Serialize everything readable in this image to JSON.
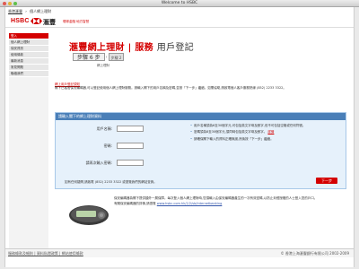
{
  "window": {
    "title": "Welcome to HSBC"
  },
  "breadcrumb": {
    "items": [
      "香港滙豐",
      "個人網上理財"
    ]
  },
  "brand": {
    "logo_text": "HSBC",
    "chinese_name": "滙豐",
    "tagline": "環球金融 地方智慧",
    "colors": {
      "brand_red": "#d40000",
      "panel_blue": "#4a7fb8",
      "panel_bg": "#e6f1fb"
    }
  },
  "sidebar": {
    "items": [
      "登入",
      "個人網上理財",
      "保安資訊",
      "使用條款",
      "最新消息",
      "常見問題",
      "聯絡我們"
    ]
  },
  "page": {
    "title_prefix": "滙豐網上理財",
    "title_sep": "|",
    "title_link": "服務",
    "title_main": "用戶登記",
    "step_current": "步驟 6 步",
    "step_next": "步驟 2",
    "step_sub": "網上理財"
  },
  "info": {
    "heading": "網上用戶登記須知",
    "text": "閣下已獲發保安編碼器,可以登記使用個人網上理財服務。請輸入閣下的用戶名稱及密碼,並按「下一步」繼續。如需協助,請致電個人客戶服務熱線 (852) 2233 3322。"
  },
  "form": {
    "header": "請輸入閣下的網上理財資料",
    "label_username": "用戶名稱:",
    "label_password": "密碼:",
    "label_confirm": "請再次輸入密碼:",
    "username_value": "",
    "password_value": "",
    "confirm_value": "",
    "tip1_text": "用戶名稱須為6至30個字元,可包括英文字母及數字,但不可包括空格或任何符號。",
    "tip2_text": "密碼須為8至30個字元,須同時包括英文字母及數字。",
    "tip2_link": "詳情",
    "tip3_text": "請確保閣下輸入的資料正確無誤,然後按「下一步」繼續。",
    "next_label": "下一步",
    "bottom_note": "如有任何疑問,請致電 (852) 2233 3322 或瀏覽我們的網站查詢。"
  },
  "device": {
    "description": "保安編碼器為閣下提供額外一層保障。每次登入個人網上理財時,您須輸入由保安編碼器產生的一次有效密碼,以防止未經授權的人士登入您的戶口。",
    "link_intro": "有關保安編碼器的詳情,請瀏覽",
    "link": "www.hsbc.com.hk/1/2/sb/internetbanking"
  },
  "footer": {
    "left": "服務條款及細則 | 資料私隱政策 | 網站使用條款",
    "right": "© 香港上海滙豐銀行有限公司 2002-2009"
  }
}
